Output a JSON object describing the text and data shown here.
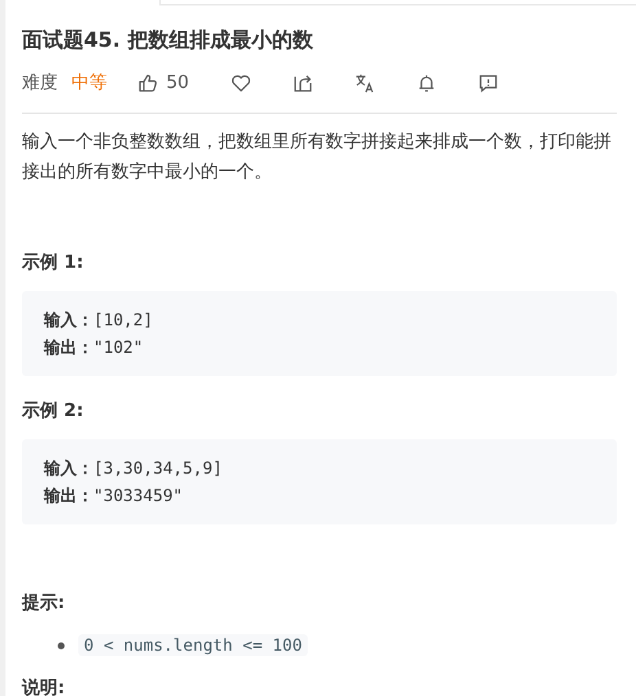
{
  "title": "面试题45. 把数组排成最小的数",
  "meta": {
    "difficulty_label": "难度",
    "difficulty": "中等",
    "actions": [
      {
        "kind": "like",
        "count": "50"
      },
      {
        "kind": "favorite"
      },
      {
        "kind": "share"
      },
      {
        "kind": "translate"
      },
      {
        "kind": "notify"
      },
      {
        "kind": "feedback"
      }
    ]
  },
  "description": "输入一个非负整数数组，把数组里所有数字拼接起来排成一个数，打印能拼接出的所有数字中最小的一个。",
  "examples": [
    {
      "heading": "示例 1:",
      "lines": [
        {
          "label": "输入：",
          "value": "[10,2]"
        },
        {
          "label": "输出：",
          "value": "\"102\""
        }
      ]
    },
    {
      "heading": "示例 2:",
      "lines": [
        {
          "label": "输入：",
          "value": "[3,30,34,5,9]"
        },
        {
          "label": "输出：",
          "value": "\"3033459\""
        }
      ]
    }
  ],
  "hints": {
    "heading": "提示:",
    "items": [
      "0 < nums.length <= 100"
    ]
  },
  "notes": {
    "heading": "说明:"
  }
}
